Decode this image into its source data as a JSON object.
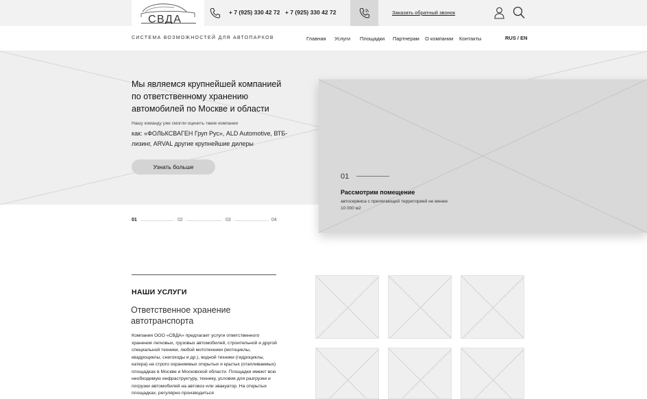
{
  "header": {
    "logo_text": "СВДА",
    "phone_1": "+ 7 (925) 330 42 72",
    "phone_2": "+ 7 (925) 330 42 72",
    "callback_link": "Заказать обратный звонок",
    "icons": [
      "phone-icon",
      "phone-call-icon",
      "user-icon",
      "search-icon"
    ]
  },
  "nav": {
    "tagline": "СИСТЕМА ВОЗМОЖНОСТЕЙ ДЛЯ АВТОПАРКОВ",
    "items": [
      "Главная",
      "Услуги",
      "Площадки",
      "Партнерам",
      "О компании",
      "Контакты"
    ],
    "lang": "RUS / EN"
  },
  "hero": {
    "title": "Мы являемся крупнейшей компанией по ответственному хранению автомобилей по Москве и области",
    "note": "Нашу команду уже смогли оценить такие компании",
    "clients": "как: «ФОЛЬКСВАГЕН Груп Рус», ALD Automotive, ВТБ-лизинг, ARVAL другие крупнейшие дилеры",
    "button": "Узнать больше",
    "slides": [
      "01",
      "02",
      "03",
      "04"
    ],
    "card": {
      "number": "01",
      "title": "Рассмотрим помещение",
      "description": "автосервиса с прилегающей территорией не менее 10 000 м2"
    }
  },
  "services": {
    "heading": "НАШИ УСЛУГИ",
    "subtitle": "Ответственное хранение автотранспорта",
    "text": "Компания ООО «СВДА» предлагает услуги ответственного хранения легковых, грузовых автомобилей, строительной и другой специальной техники, любой мототехники (мотоциклы, квадроциклы, снегоходы и др.), водной техники (гидроциклы, катера) на строго охраняемых открытых и крытых (отапливаемых) площадках в Москве и Московской области. Площадки имеют всю необходимую инфраструктуру, технику, условия для разгрузки и погрузки автомобилей на автовоз или эвакуатор. На открытых площадках, регулярно производиться"
  }
}
